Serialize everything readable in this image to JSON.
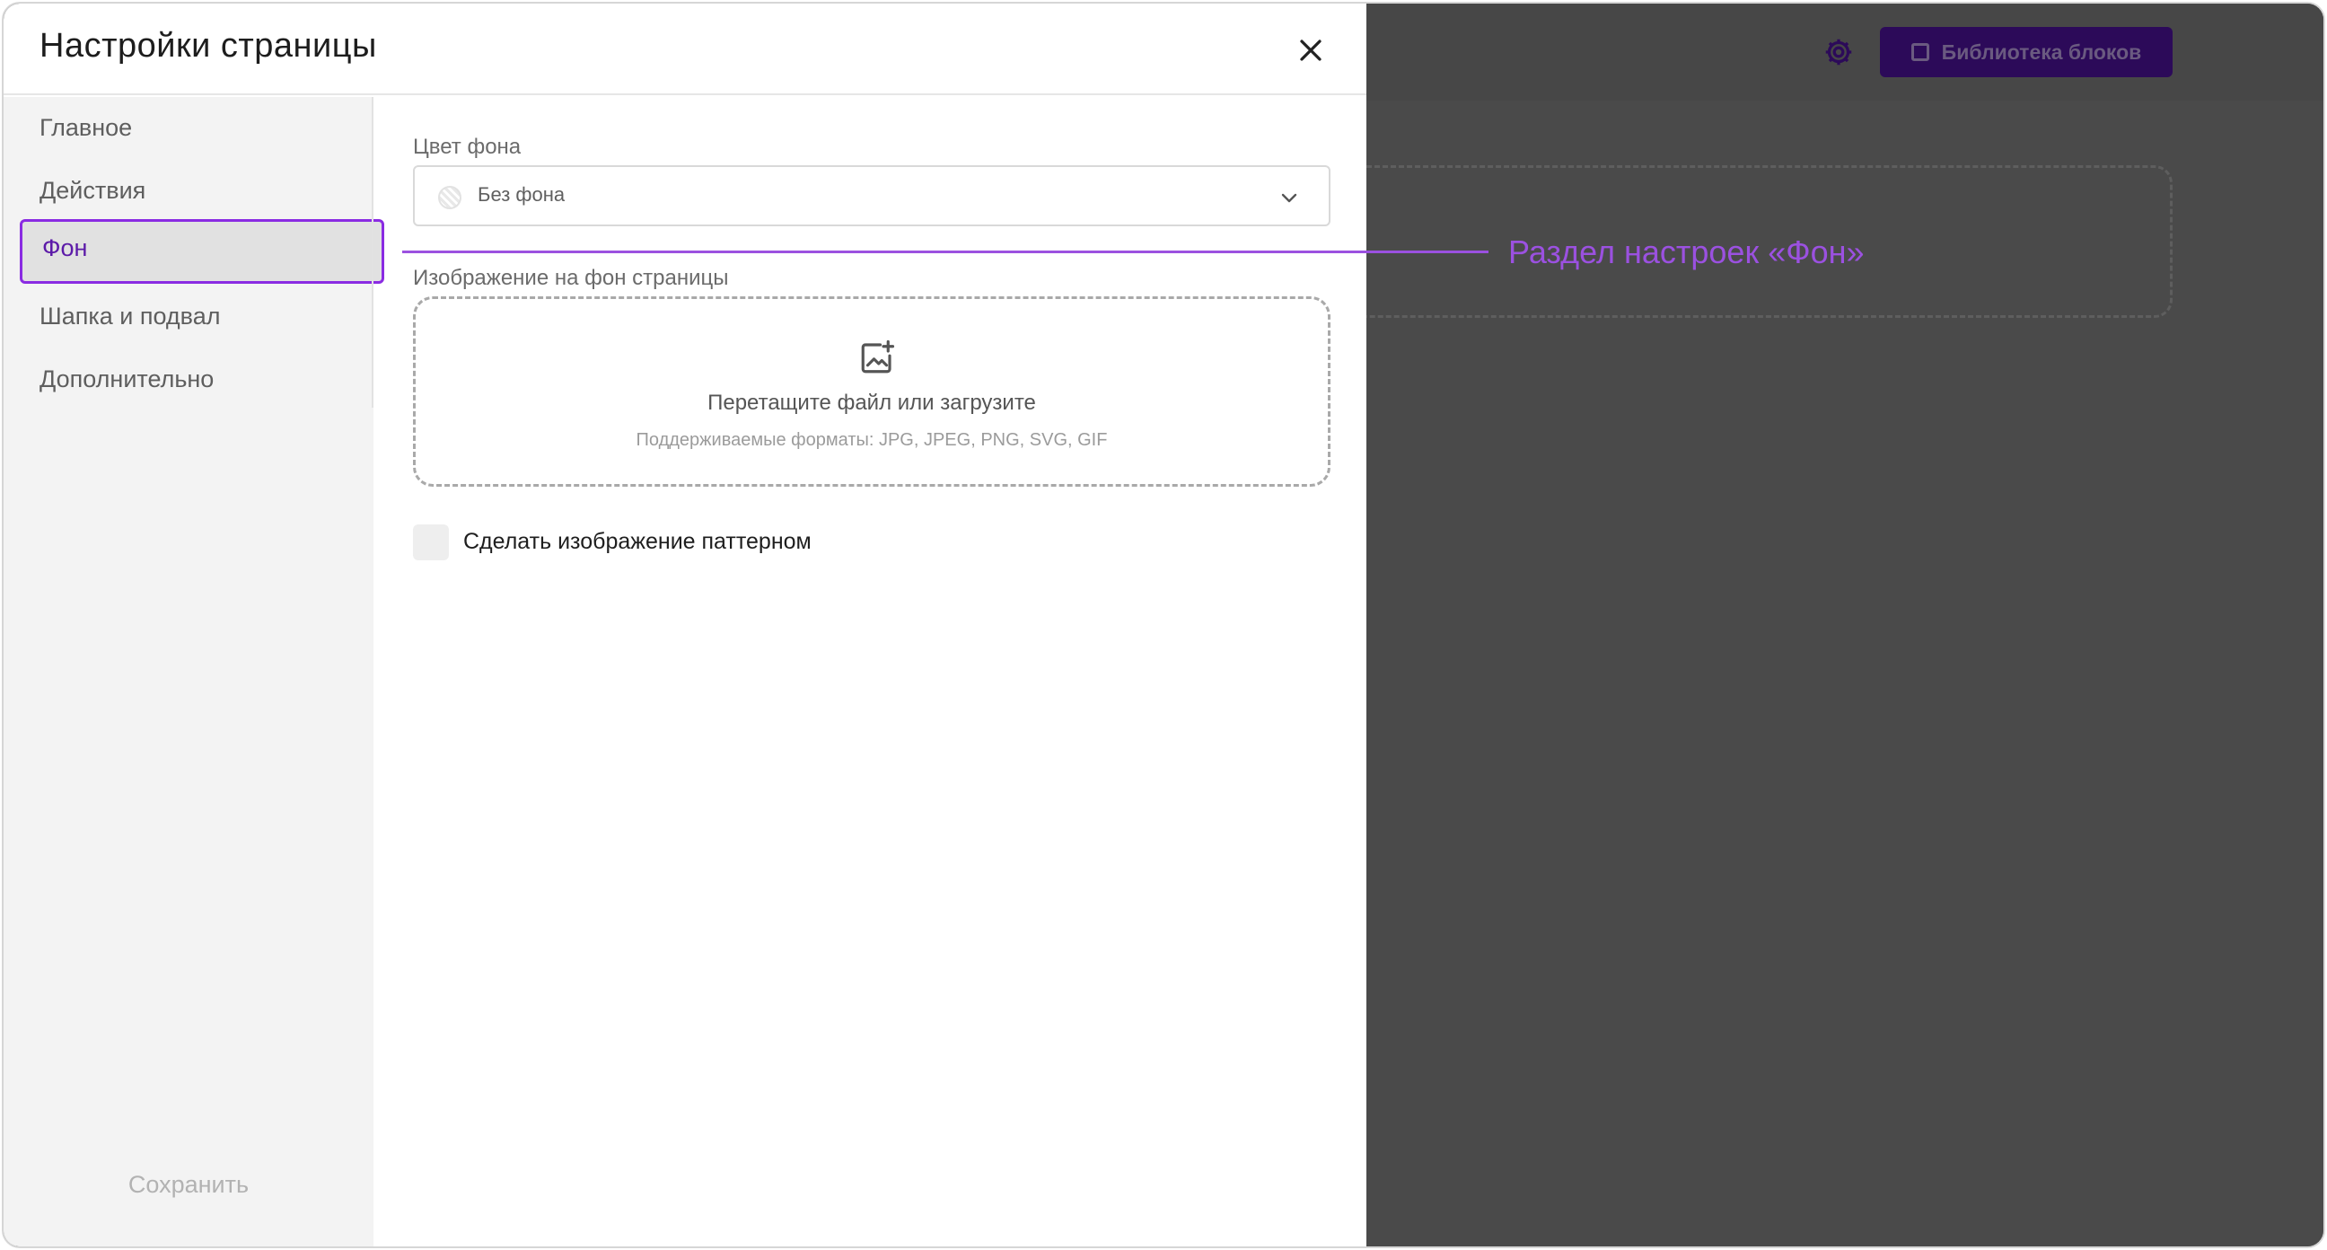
{
  "modal": {
    "title": "Настройки страницы",
    "close_icon": "close-icon"
  },
  "sidebar": {
    "items": [
      {
        "label": "Главное",
        "active": false
      },
      {
        "label": "Действия",
        "active": false
      },
      {
        "label": "Фон",
        "active": true
      },
      {
        "label": "Шапка и подвал",
        "active": false
      },
      {
        "label": "Дополнительно",
        "active": false
      }
    ],
    "save_label": "Сохранить"
  },
  "background_settings": {
    "color_label": "Цвет фона",
    "color_value": "Без фона",
    "image_label": "Изображение на фон страницы",
    "dropzone_title": "Перетащите файл или загрузите",
    "dropzone_formats": "Поддерживаемые форматы: JPG, JPEG, PNG, SVG, GIF",
    "pattern_label": "Сделать изображение паттерном",
    "pattern_checked": false
  },
  "editor_backdrop": {
    "library_button": "Библиотека блоков",
    "settings_icon": "gear-icon"
  },
  "annotation": {
    "text": "Раздел настроек «Фон»"
  },
  "colors": {
    "accent": "#8a2be2",
    "annotation": "#9b51e0",
    "backdrop": "#4a4a4a"
  }
}
